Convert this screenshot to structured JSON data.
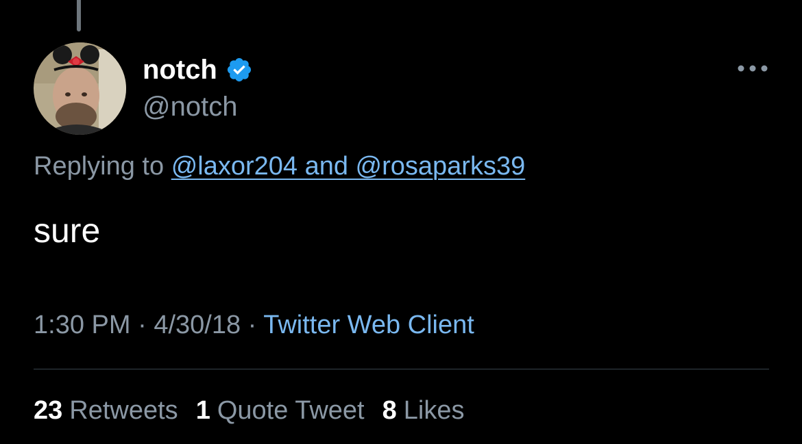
{
  "tweet": {
    "author": {
      "display_name": "notch",
      "handle": "@notch",
      "verified": true,
      "verified_badge_icon": "verified-badge-icon",
      "avatar_icon": "avatar"
    },
    "more_icon": "more-options-icon",
    "replying_prefix": "Replying to",
    "replying_mentions": "@laxor204 and @rosaparks39",
    "text": "sure",
    "time": "1:30 PM",
    "date": "4/30/18",
    "separator": "·",
    "source": "Twitter Web Client",
    "stats": {
      "retweets_count": "23",
      "retweets_label": "Retweets",
      "quotes_count": "1",
      "quotes_label": "Quote Tweet",
      "likes_count": "8",
      "likes_label": "Likes"
    }
  },
  "colors": {
    "background": "#000000",
    "primary_text": "#ffffff",
    "secondary_text": "#8b98a5",
    "link": "#7ab8f0",
    "verified": "#1d9bf0",
    "divider": "#38444d",
    "thread_line": "#6e767d"
  }
}
